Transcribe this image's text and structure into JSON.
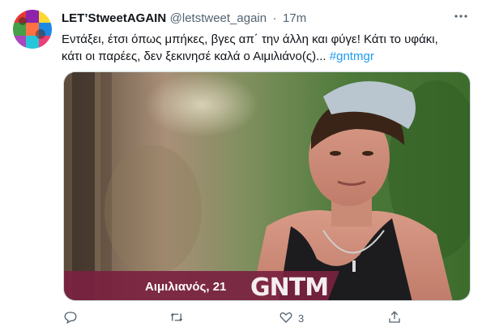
{
  "tweet": {
    "display_name": "LET’StweetAGAIN",
    "handle": "@letstweet_again",
    "separator": "·",
    "time": "17m",
    "text_line1": "Εντάξει, έτσι όπως μπήκες, βγες απ΄ την άλλη και φύγε! Κάτι το υφάκι,",
    "text_line2": "κάτι οι παρέες, δεν ξεκινησέ καλά ο Αιμιλιάνο(ς)...",
    "hashtag": "#gntmgr",
    "media": {
      "caption": "Αιμιλιανός, 21",
      "logo": "GNTM"
    },
    "actions": {
      "like_count": "3"
    }
  },
  "colors": {
    "accent": "#1d9bf0",
    "secondary_text": "#536471",
    "caption_bar": "#7a2240"
  },
  "icons": [
    "more-icon",
    "reply-icon",
    "retweet-icon",
    "like-icon",
    "share-icon"
  ]
}
